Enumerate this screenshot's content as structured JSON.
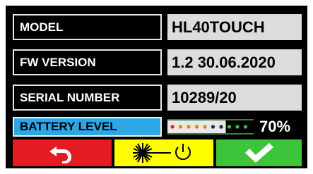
{
  "rows": [
    {
      "label": "MODEL",
      "value": "HL40TOUCH"
    },
    {
      "label": "FW VERSION",
      "value": "1.2 30.06.2020"
    },
    {
      "label": "SERIAL NUMBER",
      "value": "10289/20"
    }
  ],
  "battery": {
    "label": "BATTERY LEVEL",
    "percent_text": "70%",
    "level": 0.7
  },
  "buttons": {
    "back_icon": "undo-arrow-icon",
    "laser_icon": "laser-power-icon",
    "ok_icon": "checkmark-icon"
  },
  "colors": {
    "back": "#e41b23",
    "laser": "#ffff00",
    "ok": "#3cc43b",
    "battery_label_bg": "#2ea6e6",
    "value_bg": "#dcdcdc"
  }
}
